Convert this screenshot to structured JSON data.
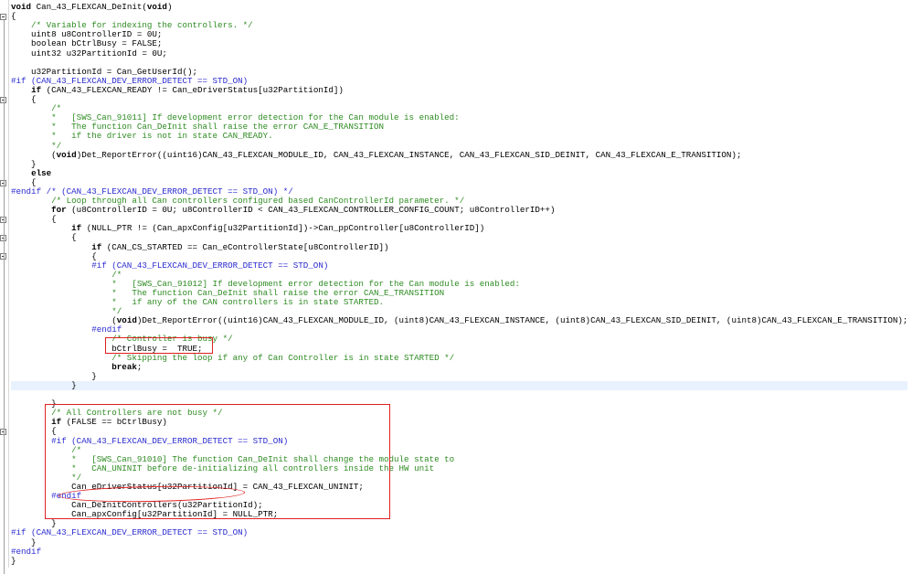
{
  "editor": {
    "lines": [
      {
        "t": "/* ... */",
        "k": "cm"
      },
      {
        "t": "void Can_43_FLEXCAN_DeInit(void)",
        "k": "sig"
      },
      {
        "t": "{",
        "k": "n"
      },
      {
        "t": "    /* Variable for indexing the controllers. */",
        "k": "cm"
      },
      {
        "t": "    uint8 u8ControllerID = 0U;",
        "k": "n"
      },
      {
        "t": "    boolean bCtrlBusy = FALSE;",
        "k": "n"
      },
      {
        "t": "    uint32 u32PartitionId = 0U;",
        "k": "n"
      },
      {
        "t": "",
        "k": "n"
      },
      {
        "t": "    u32PartitionId = Can_GetUserId();",
        "k": "n"
      },
      {
        "t": "#if (CAN_43_FLEXCAN_DEV_ERROR_DETECT == STD_ON)",
        "k": "pp"
      },
      {
        "t": "    if (CAN_43_FLEXCAN_READY != Can_eDriverStatus[u32PartitionId])",
        "k": "if"
      },
      {
        "t": "    {",
        "k": "n"
      },
      {
        "t": "        /*",
        "k": "cm"
      },
      {
        "t": "        *   [SWS_Can_91011] If development error detection for the Can module is enabled:",
        "k": "cm"
      },
      {
        "t": "        *   The function Can_DeInit shall raise the error CAN_E_TRANSITION",
        "k": "cm"
      },
      {
        "t": "        *   if the driver is not in state CAN_READY.",
        "k": "cm"
      },
      {
        "t": "        */",
        "k": "cm"
      },
      {
        "t": "        (void)Det_ReportError((uint16)CAN_43_FLEXCAN_MODULE_ID, CAN_43_FLEXCAN_INSTANCE, CAN_43_FLEXCAN_SID_DEINIT, CAN_43_FLEXCAN_E_TRANSITION);",
        "k": "void"
      },
      {
        "t": "    }",
        "k": "n"
      },
      {
        "t": "    else",
        "k": "kwline"
      },
      {
        "t": "    {",
        "k": "n"
      },
      {
        "t": "#endif /* (CAN_43_FLEXCAN_DEV_ERROR_DETECT == STD_ON) */",
        "k": "pp"
      },
      {
        "t": "        /* Loop through all Can controllers configured based CanControllerId parameter. */",
        "k": "cm"
      },
      {
        "t": "        for (u8ControllerID = 0U; u8ControllerID < CAN_43_FLEXCAN_CONTROLLER_CONFIG_COUNT; u8ControllerID++)",
        "k": "for"
      },
      {
        "t": "        {",
        "k": "n"
      },
      {
        "t": "            if (NULL_PTR != (Can_apxConfig[u32PartitionId])->Can_ppController[u8ControllerID])",
        "k": "if"
      },
      {
        "t": "            {",
        "k": "n"
      },
      {
        "t": "                if (CAN_CS_STARTED == Can_eControllerState[u8ControllerID])",
        "k": "if"
      },
      {
        "t": "                {",
        "k": "n"
      },
      {
        "t": "                #if (CAN_43_FLEXCAN_DEV_ERROR_DETECT == STD_ON)",
        "k": "pp"
      },
      {
        "t": "                    /*",
        "k": "cm"
      },
      {
        "t": "                    *   [SWS_Can_91012] If development error detection for the Can module is enabled:",
        "k": "cm"
      },
      {
        "t": "                    *   The function Can_DeInit shall raise the error CAN_E_TRANSITION",
        "k": "cm"
      },
      {
        "t": "                    *   if any of the CAN controllers is in state STARTED.",
        "k": "cm"
      },
      {
        "t": "                    */",
        "k": "cm"
      },
      {
        "t": "                    (void)Det_ReportError((uint16)CAN_43_FLEXCAN_MODULE_ID, (uint8)CAN_43_FLEXCAN_INSTANCE, (uint8)CAN_43_FLEXCAN_SID_DEINIT, (uint8)CAN_43_FLEXCAN_E_TRANSITION);",
        "k": "void"
      },
      {
        "t": "                #endif",
        "k": "pp"
      },
      {
        "t": "                    /* Controller is busy */",
        "k": "cm"
      },
      {
        "t": "                    bCtrlBusy =  TRUE;",
        "k": "n"
      },
      {
        "t": "                    /* Skipping the loop if any of Can Controller is in state STARTED */",
        "k": "cm"
      },
      {
        "t": "                    break;",
        "k": "break"
      },
      {
        "t": "                }",
        "k": "n"
      },
      {
        "t": "            }",
        "k": "n"
      },
      {
        "t": "",
        "k": "n"
      },
      {
        "t": "        }",
        "k": "n"
      },
      {
        "t": "        /* All Controllers are not busy */",
        "k": "cm"
      },
      {
        "t": "        if (FALSE == bCtrlBusy)",
        "k": "if"
      },
      {
        "t": "        {",
        "k": "n"
      },
      {
        "t": "        #if (CAN_43_FLEXCAN_DEV_ERROR_DETECT == STD_ON)",
        "k": "pp"
      },
      {
        "t": "            /*",
        "k": "cm"
      },
      {
        "t": "            *   [SWS_Can_91010] The function Can_DeInit shall change the module state to",
        "k": "cm"
      },
      {
        "t": "            *   CAN_UNINIT before de-initializing all controllers inside the HW unit",
        "k": "cm"
      },
      {
        "t": "            */",
        "k": "cm"
      },
      {
        "t": "            Can_eDriverStatus[u32PartitionId] = CAN_43_FLEXCAN_UNINIT;",
        "k": "n"
      },
      {
        "t": "        #endif",
        "k": "pp"
      },
      {
        "t": "            Can_DeInitControllers(u32PartitionId);",
        "k": "n"
      },
      {
        "t": "            Can_apxConfig[u32PartitionId] = NULL_PTR;",
        "k": "n"
      },
      {
        "t": "        }",
        "k": "n"
      },
      {
        "t": "#if (CAN_43_FLEXCAN_DEV_ERROR_DETECT == STD_ON)",
        "k": "pp"
      },
      {
        "t": "    }",
        "k": "n"
      },
      {
        "t": "#endif",
        "k": "pp"
      },
      {
        "t": "}",
        "k": "n"
      }
    ]
  },
  "colors": {
    "keyword": "#000000",
    "comment": "#2e8b22",
    "preprocessor": "#2a2ad0",
    "annotation": "#e02020"
  }
}
